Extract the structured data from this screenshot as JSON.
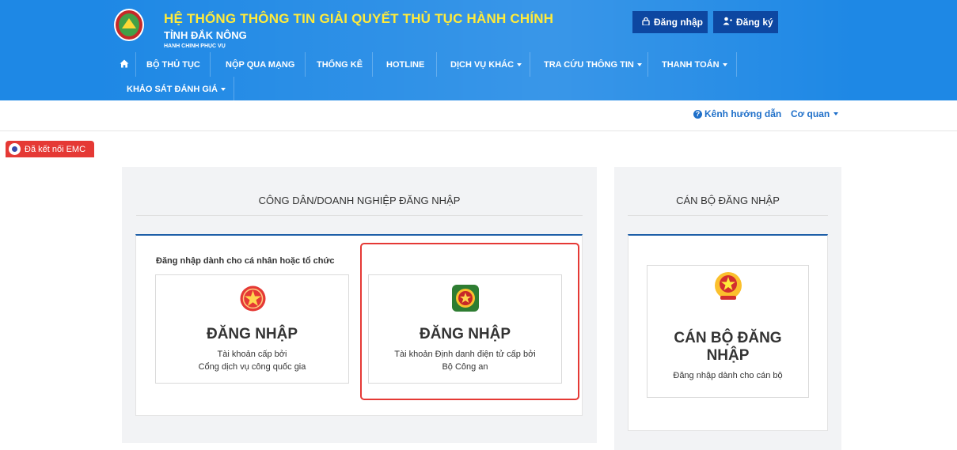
{
  "header": {
    "title": "HỆ THỐNG THÔNG TIN GIẢI QUYẾT THỦ TỤC HÀNH CHÍNH",
    "subtitle": "TỈNH ĐẮK NÔNG",
    "tagline": "HÀNH CHÍNH PHỤC VỤ",
    "login_label": "Đăng nhập",
    "register_label": "Đăng ký"
  },
  "nav": {
    "items": [
      {
        "label": "BỘ THỦ TỤC"
      },
      {
        "label": "NỘP QUA MẠNG"
      },
      {
        "label": "THỐNG KÊ"
      },
      {
        "label": "HOTLINE"
      },
      {
        "label": "DỊCH VỤ KHÁC"
      },
      {
        "label": "TRA CỨU THÔNG TIN"
      },
      {
        "label": "THANH TOÁN"
      },
      {
        "label": "KHẢO SÁT ĐÁNH GIÁ"
      }
    ]
  },
  "subbar": {
    "guide_label": "Kênh hướng dẫn",
    "org_label": "Cơ quan"
  },
  "emc": {
    "label": "Đã kết nối EMC"
  },
  "citizen": {
    "title": "CÔNG DÂN/DOANH NGHIỆP ĐĂNG NHẬP",
    "hint": "Đăng nhập dành cho cá nhân hoặc tổ chức",
    "card1": {
      "title": "ĐĂNG NHẬP",
      "line1": "Tài khoản cấp bởi",
      "line2": "Cổng dịch vụ công quốc gia"
    },
    "card2": {
      "title": "ĐĂNG NHẬP",
      "line1": "Tài khoản Định danh điện tử cấp bởi",
      "line2": "Bộ Công an"
    }
  },
  "officer": {
    "title": "CÁN BỘ ĐĂNG NHẬP",
    "card_title_line1": "CÁN BỘ ĐĂNG",
    "card_title_line2": "NHẬP",
    "card_desc": "Đăng nhập dành cho cán bộ"
  },
  "colors": {
    "header_bg": "#1e88e5",
    "title_yellow": "#ffeb3b",
    "button_dark": "#0d47a1",
    "highlight_red": "#e53935",
    "panel_bg": "#f2f3f5"
  }
}
